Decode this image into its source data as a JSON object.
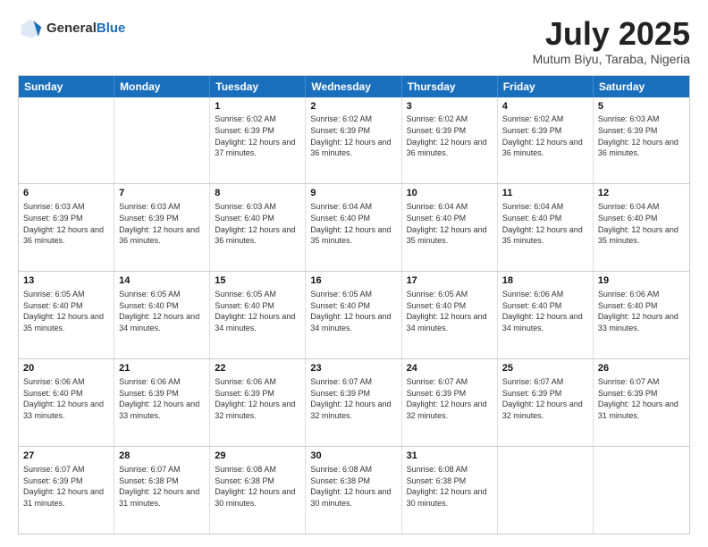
{
  "header": {
    "logo_general": "General",
    "logo_blue": "Blue",
    "month_title": "July 2025",
    "subtitle": "Mutum Biyu, Taraba, Nigeria"
  },
  "weekdays": [
    "Sunday",
    "Monday",
    "Tuesday",
    "Wednesday",
    "Thursday",
    "Friday",
    "Saturday"
  ],
  "rows": [
    [
      {
        "num": "",
        "info": ""
      },
      {
        "num": "",
        "info": ""
      },
      {
        "num": "1",
        "info": "Sunrise: 6:02 AM\nSunset: 6:39 PM\nDaylight: 12 hours and 37 minutes."
      },
      {
        "num": "2",
        "info": "Sunrise: 6:02 AM\nSunset: 6:39 PM\nDaylight: 12 hours and 36 minutes."
      },
      {
        "num": "3",
        "info": "Sunrise: 6:02 AM\nSunset: 6:39 PM\nDaylight: 12 hours and 36 minutes."
      },
      {
        "num": "4",
        "info": "Sunrise: 6:02 AM\nSunset: 6:39 PM\nDaylight: 12 hours and 36 minutes."
      },
      {
        "num": "5",
        "info": "Sunrise: 6:03 AM\nSunset: 6:39 PM\nDaylight: 12 hours and 36 minutes."
      }
    ],
    [
      {
        "num": "6",
        "info": "Sunrise: 6:03 AM\nSunset: 6:39 PM\nDaylight: 12 hours and 36 minutes."
      },
      {
        "num": "7",
        "info": "Sunrise: 6:03 AM\nSunset: 6:39 PM\nDaylight: 12 hours and 36 minutes."
      },
      {
        "num": "8",
        "info": "Sunrise: 6:03 AM\nSunset: 6:40 PM\nDaylight: 12 hours and 36 minutes."
      },
      {
        "num": "9",
        "info": "Sunrise: 6:04 AM\nSunset: 6:40 PM\nDaylight: 12 hours and 35 minutes."
      },
      {
        "num": "10",
        "info": "Sunrise: 6:04 AM\nSunset: 6:40 PM\nDaylight: 12 hours and 35 minutes."
      },
      {
        "num": "11",
        "info": "Sunrise: 6:04 AM\nSunset: 6:40 PM\nDaylight: 12 hours and 35 minutes."
      },
      {
        "num": "12",
        "info": "Sunrise: 6:04 AM\nSunset: 6:40 PM\nDaylight: 12 hours and 35 minutes."
      }
    ],
    [
      {
        "num": "13",
        "info": "Sunrise: 6:05 AM\nSunset: 6:40 PM\nDaylight: 12 hours and 35 minutes."
      },
      {
        "num": "14",
        "info": "Sunrise: 6:05 AM\nSunset: 6:40 PM\nDaylight: 12 hours and 34 minutes."
      },
      {
        "num": "15",
        "info": "Sunrise: 6:05 AM\nSunset: 6:40 PM\nDaylight: 12 hours and 34 minutes."
      },
      {
        "num": "16",
        "info": "Sunrise: 6:05 AM\nSunset: 6:40 PM\nDaylight: 12 hours and 34 minutes."
      },
      {
        "num": "17",
        "info": "Sunrise: 6:05 AM\nSunset: 6:40 PM\nDaylight: 12 hours and 34 minutes."
      },
      {
        "num": "18",
        "info": "Sunrise: 6:06 AM\nSunset: 6:40 PM\nDaylight: 12 hours and 34 minutes."
      },
      {
        "num": "19",
        "info": "Sunrise: 6:06 AM\nSunset: 6:40 PM\nDaylight: 12 hours and 33 minutes."
      }
    ],
    [
      {
        "num": "20",
        "info": "Sunrise: 6:06 AM\nSunset: 6:40 PM\nDaylight: 12 hours and 33 minutes."
      },
      {
        "num": "21",
        "info": "Sunrise: 6:06 AM\nSunset: 6:39 PM\nDaylight: 12 hours and 33 minutes."
      },
      {
        "num": "22",
        "info": "Sunrise: 6:06 AM\nSunset: 6:39 PM\nDaylight: 12 hours and 32 minutes."
      },
      {
        "num": "23",
        "info": "Sunrise: 6:07 AM\nSunset: 6:39 PM\nDaylight: 12 hours and 32 minutes."
      },
      {
        "num": "24",
        "info": "Sunrise: 6:07 AM\nSunset: 6:39 PM\nDaylight: 12 hours and 32 minutes."
      },
      {
        "num": "25",
        "info": "Sunrise: 6:07 AM\nSunset: 6:39 PM\nDaylight: 12 hours and 32 minutes."
      },
      {
        "num": "26",
        "info": "Sunrise: 6:07 AM\nSunset: 6:39 PM\nDaylight: 12 hours and 31 minutes."
      }
    ],
    [
      {
        "num": "27",
        "info": "Sunrise: 6:07 AM\nSunset: 6:39 PM\nDaylight: 12 hours and 31 minutes."
      },
      {
        "num": "28",
        "info": "Sunrise: 6:07 AM\nSunset: 6:38 PM\nDaylight: 12 hours and 31 minutes."
      },
      {
        "num": "29",
        "info": "Sunrise: 6:08 AM\nSunset: 6:38 PM\nDaylight: 12 hours and 30 minutes."
      },
      {
        "num": "30",
        "info": "Sunrise: 6:08 AM\nSunset: 6:38 PM\nDaylight: 12 hours and 30 minutes."
      },
      {
        "num": "31",
        "info": "Sunrise: 6:08 AM\nSunset: 6:38 PM\nDaylight: 12 hours and 30 minutes."
      },
      {
        "num": "",
        "info": ""
      },
      {
        "num": "",
        "info": ""
      }
    ]
  ]
}
